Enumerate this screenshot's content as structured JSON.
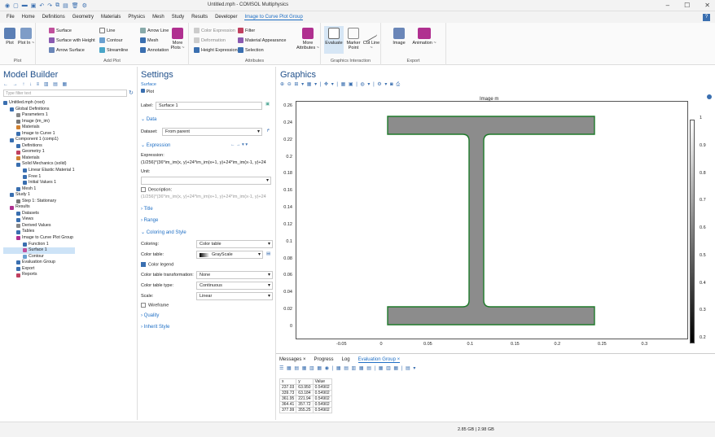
{
  "window": {
    "title": "Untitled.mph - COMSOL Multiphysics"
  },
  "menu": [
    "File",
    "Home",
    "Definitions",
    "Geometry",
    "Materials",
    "Physics",
    "Mesh",
    "Study",
    "Results",
    "Developer",
    "Image to Curve Plot Group"
  ],
  "ribbon": {
    "plot_group": {
      "label": "Plot",
      "plot": "Plot",
      "plot_in": "Plot In ~"
    },
    "add_plot": {
      "label": "Add Plot",
      "surface": "Surface",
      "surface_height": "Surface with Height",
      "arrow_surface": "Arrow Surface",
      "line": "Line",
      "contour": "Contour",
      "streamline": "Streamline",
      "arrow_line": "Arrow Line",
      "mesh": "Mesh",
      "annotation": "Annotation",
      "more_plots": "More Plots ~"
    },
    "attributes": {
      "label": "Attributes",
      "color_expression": "Color Expression",
      "deformation": "Deformation",
      "height_expression": "Height Expression",
      "filter": "Filter",
      "material_appearance": "Material Appearance",
      "selection": "Selection",
      "more_attributes": "More Attributes ~"
    },
    "graphics_interaction": {
      "label": "Graphics Interaction",
      "evaluate": "Evaluate",
      "marker_point": "Marker Point",
      "cut_line": "Cut Line ~"
    },
    "export": {
      "label": "Export",
      "image": "Image",
      "animation": "Animation ~"
    }
  },
  "model_builder": {
    "title": "Model Builder",
    "filter_placeholder": "Type filter text",
    "tree": [
      "Untitled.mph (root)",
      "Global Definitions",
      "Parameters 1",
      "Image (im_im)",
      "Materials",
      "Image to Curve 1",
      "Component 1 (comp1)",
      "Definitions",
      "Geometry 1",
      "Materials",
      "Solid Mechanics (solid)",
      "Linear Elastic Material 1",
      "Free 1",
      "Initial Values 1",
      "Mesh 1",
      "Study 1",
      "Step 1: Stationary",
      "Results",
      "Datasets",
      "Views",
      "Derived Values",
      "Tables",
      "Image to Curve Plot Group",
      "Function 1",
      "Surface 1",
      "Contour",
      "Evaluation Group",
      "Export",
      "Reports"
    ]
  },
  "settings": {
    "title": "Settings",
    "subtitle": "Surface",
    "plot_label": "Plot",
    "label_label": "Label:",
    "label_value": "Surface 1",
    "data_section": "Data",
    "dataset_label": "Dataset:",
    "dataset_value": "From parent",
    "expression_section": "Expression",
    "expression_label": "Expression:",
    "expression_value": "(1/256)*(36*im_im(x, y)+24*im_im(x+1, y)+24*im_im(x-1, y)+24",
    "unit_label": "Unit:",
    "description_label": "Description:",
    "description_value": "(1/256)*(36*im_im(x, y)+24*im_im(x+1, y)+24*im_im(x-1, y)+24",
    "title_section": "Title",
    "range_section": "Range",
    "coloring_section": "Coloring and Style",
    "coloring_label": "Coloring:",
    "coloring_value": "Color table",
    "color_table_label": "Color table:",
    "color_table_value": "GrayScale",
    "color_legend": "Color legend",
    "transformation_label": "Color table transformation:",
    "transformation_value": "None",
    "ct_type_label": "Color table type:",
    "ct_type_value": "Continuous",
    "scale_label": "Scale:",
    "scale_value": "Linear",
    "wireframe": "Wireframe",
    "quality_section": "Quality",
    "inherit_section": "Inherit Style"
  },
  "graphics": {
    "title": "Graphics",
    "plot_title": "Image m",
    "yticks": [
      "0.26",
      "0.24",
      "0.22",
      "0.2",
      "0.18",
      "0.16",
      "0.14",
      "0.12",
      "0.1",
      "0.08",
      "0.06",
      "0.04",
      "0.02",
      "0"
    ],
    "xticks": [
      "-0.05",
      "0",
      "0.05",
      "0.1",
      "0.15",
      "0.2",
      "0.25",
      "0.3"
    ],
    "cbar_ticks": [
      "1",
      "0.9",
      "0.8",
      "0.7",
      "0.6",
      "0.5",
      "0.4",
      "0.3",
      "0.2"
    ]
  },
  "bottom": {
    "tabs": [
      "Messages ×",
      "Progress",
      "Log",
      "Evaluation Group ×"
    ],
    "columns": [
      "x",
      "y",
      "Value"
    ],
    "rows": [
      [
        "237.03",
        "63.950",
        "0.54902"
      ],
      [
        "339.73",
        "63.184",
        "0.54902"
      ],
      [
        "361.95",
        "221.94",
        "0.54902"
      ],
      [
        "364.41",
        "357.72",
        "0.54902"
      ],
      [
        "377.99",
        "355.25",
        "0.54902"
      ]
    ]
  },
  "status": {
    "memory": "2.85 GB | 2.98 GB"
  }
}
